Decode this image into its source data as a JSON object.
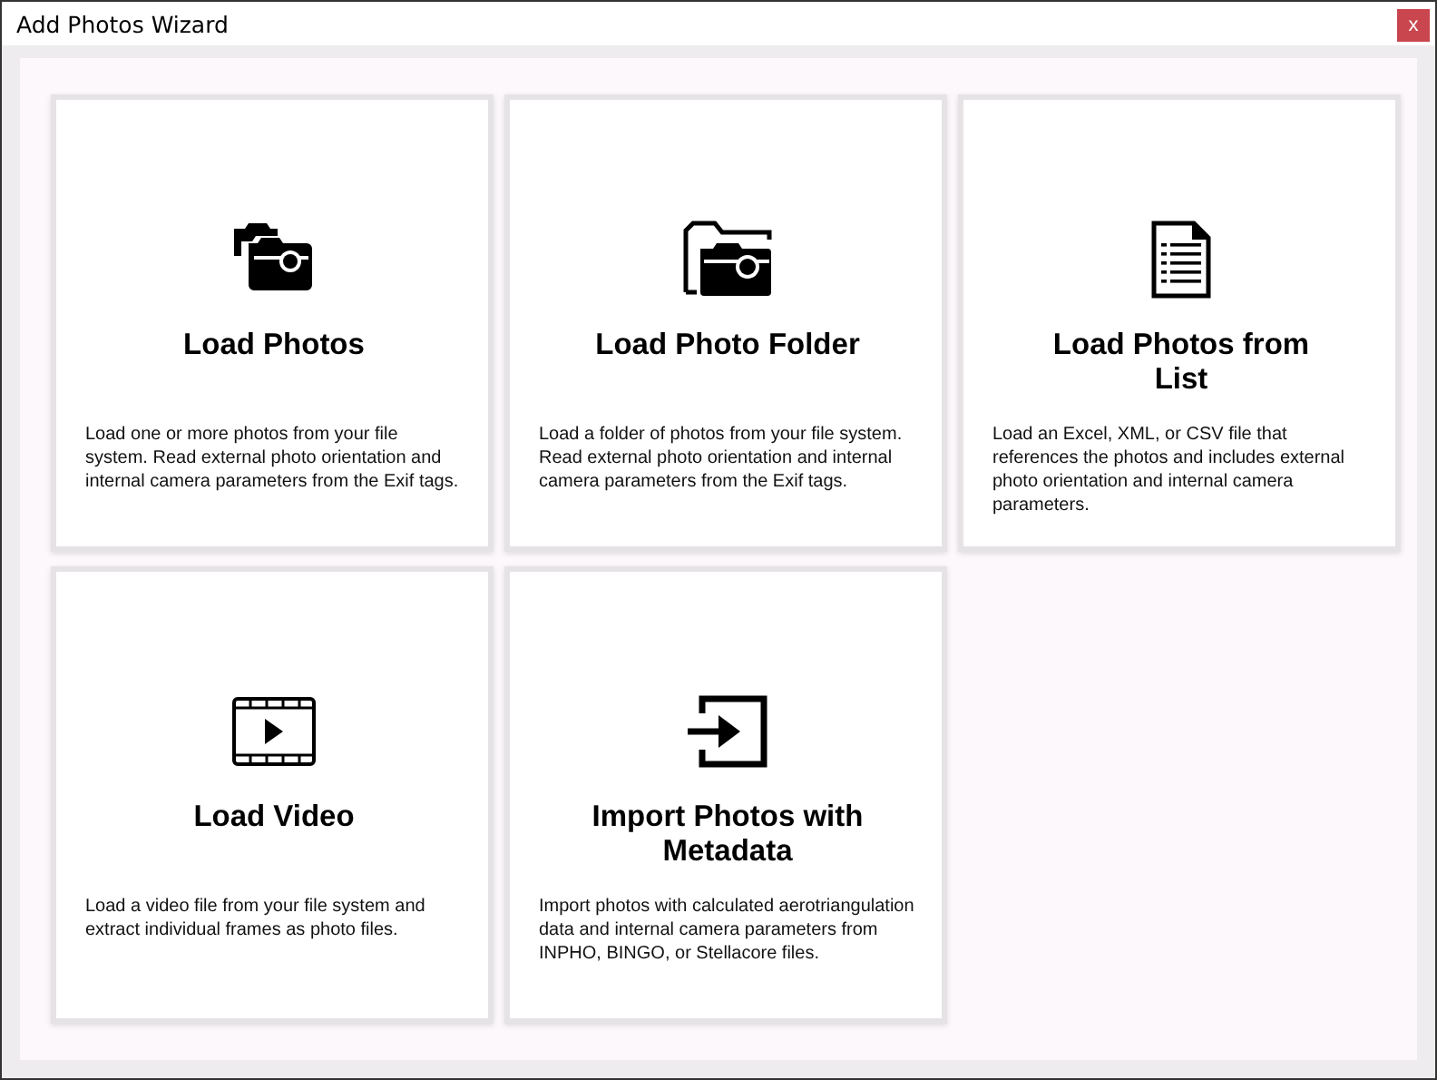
{
  "window": {
    "title": "Add Photos Wizard",
    "close": "x"
  },
  "cards": [
    {
      "kind": "photos",
      "title": "Load Photos",
      "description": "Load one or more photos from your file system. Read external photo orientation and internal camera parameters from the Exif tags."
    },
    {
      "kind": "folder",
      "title": "Load Photo Folder",
      "description": "Load a folder of photos from your file system. Read external photo orientation and internal camera parameters from the Exif tags."
    },
    {
      "kind": "list",
      "title": "Load Photos from List",
      "description": "Load an Excel, XML, or CSV file that references the photos and includes external photo orientation and internal camera parameters."
    },
    {
      "kind": "video",
      "title": "Load Video",
      "description": "Load a video file from your file system and extract individual frames as photo files."
    },
    {
      "kind": "import",
      "title": "Import Photos with Metadata",
      "description": "Import photos with calculated aerotriangulation data and internal camera parameters from INPHO, BINGO, or Stellacore files."
    }
  ]
}
